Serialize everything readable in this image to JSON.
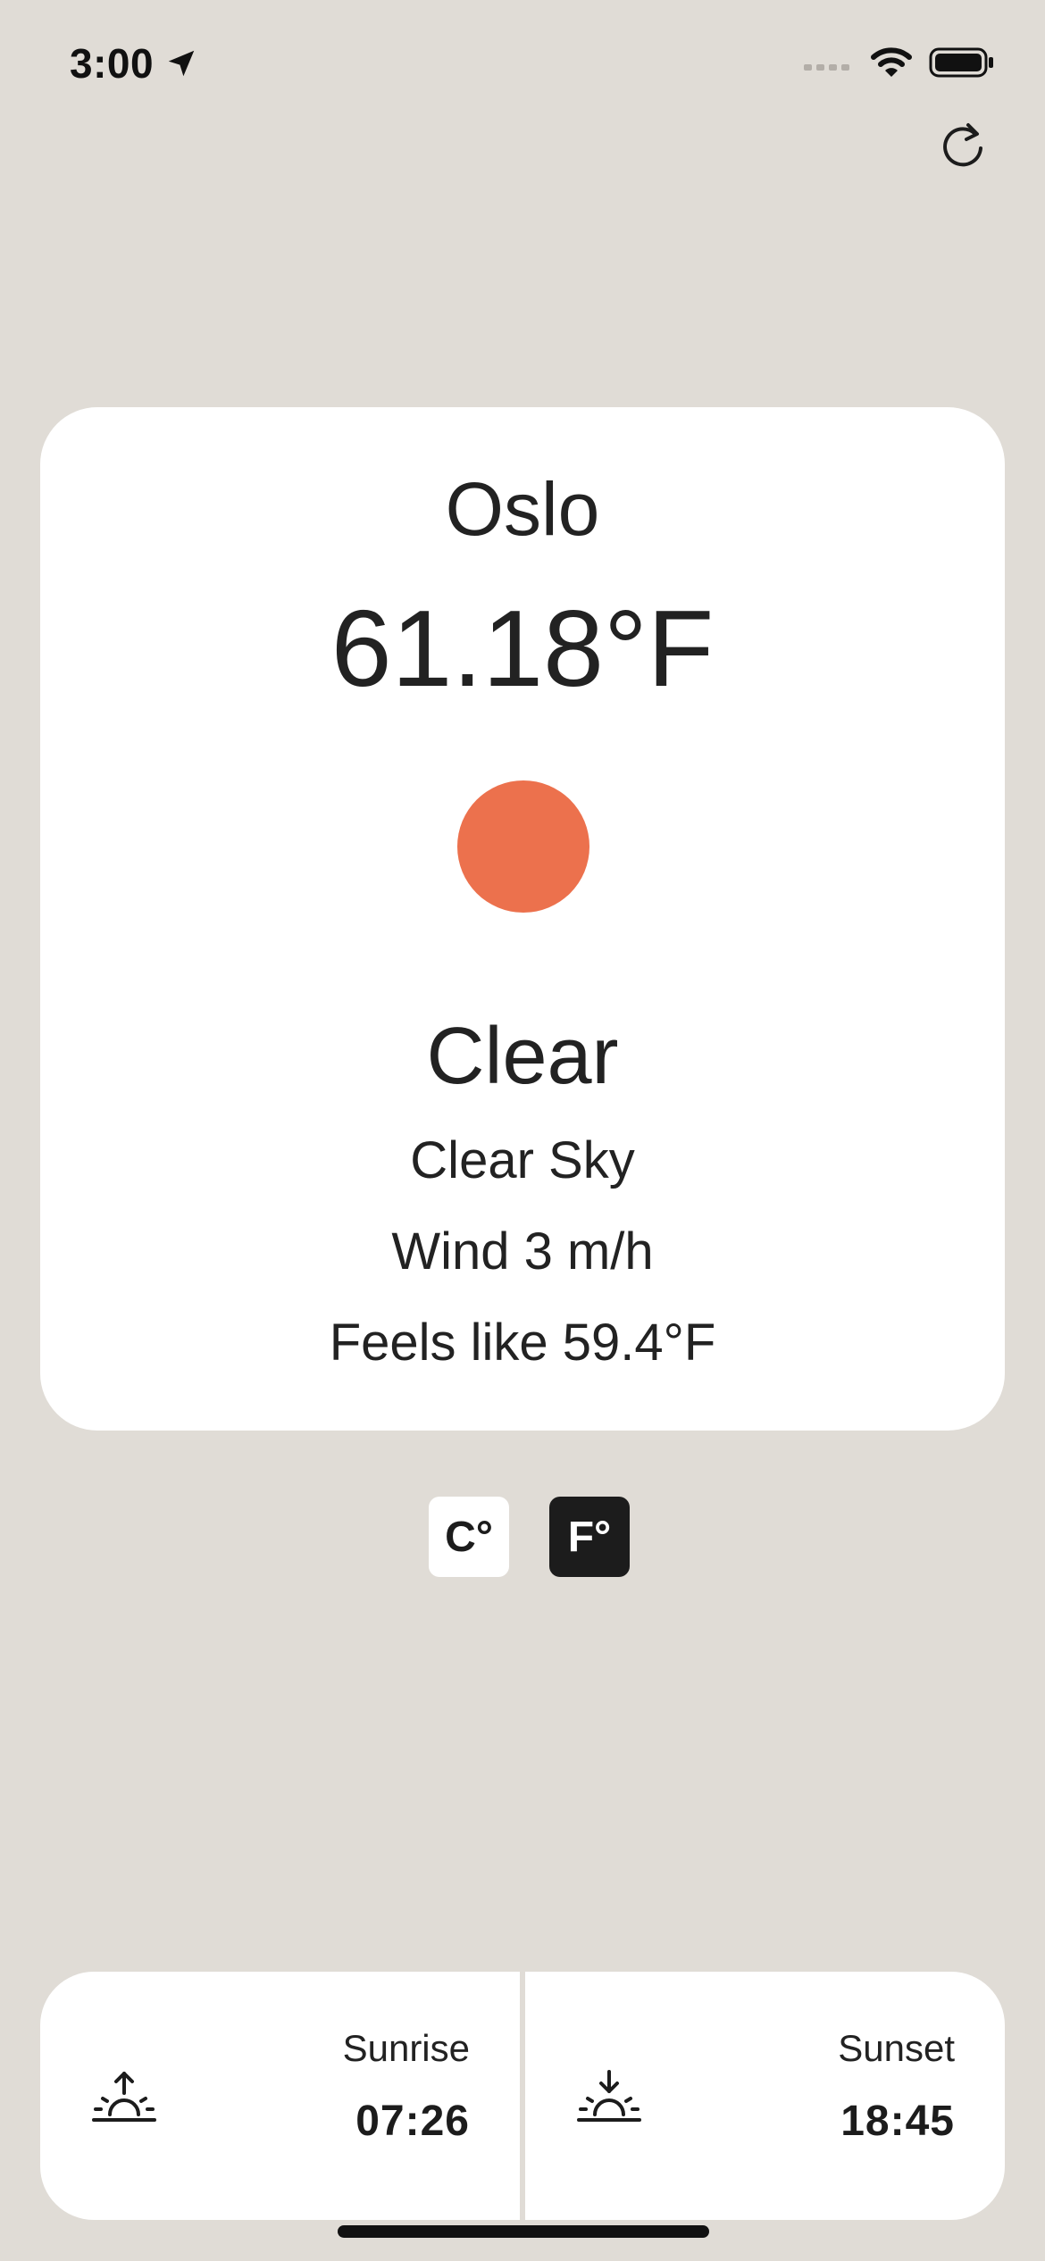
{
  "status_bar": {
    "time": "3:00",
    "icons": [
      "location-arrow-icon",
      "cellular-signal-icon",
      "wifi-icon",
      "battery-icon"
    ]
  },
  "header": {
    "refresh_icon": "refresh-icon"
  },
  "weather": {
    "city": "Oslo",
    "temperature": "61.18°F",
    "condition": "Clear",
    "description": "Clear Sky",
    "wind": "Wind 3 m/h",
    "feels_like": "Feels like 59.4°F",
    "indicator_color": "#ec714d"
  },
  "units": {
    "celsius_label": "C°",
    "fahrenheit_label": "F°",
    "selected": "fahrenheit"
  },
  "sun_times": {
    "sunrise": {
      "label": "Sunrise",
      "time": "07:26",
      "icon": "sunrise-icon"
    },
    "sunset": {
      "label": "Sunset",
      "time": "18:45",
      "icon": "sunset-icon"
    }
  },
  "colors": {
    "background": "#e0dcd6",
    "card": "#ffffff",
    "accent": "#ec714d",
    "active_toggle": "#1c1c1c"
  }
}
